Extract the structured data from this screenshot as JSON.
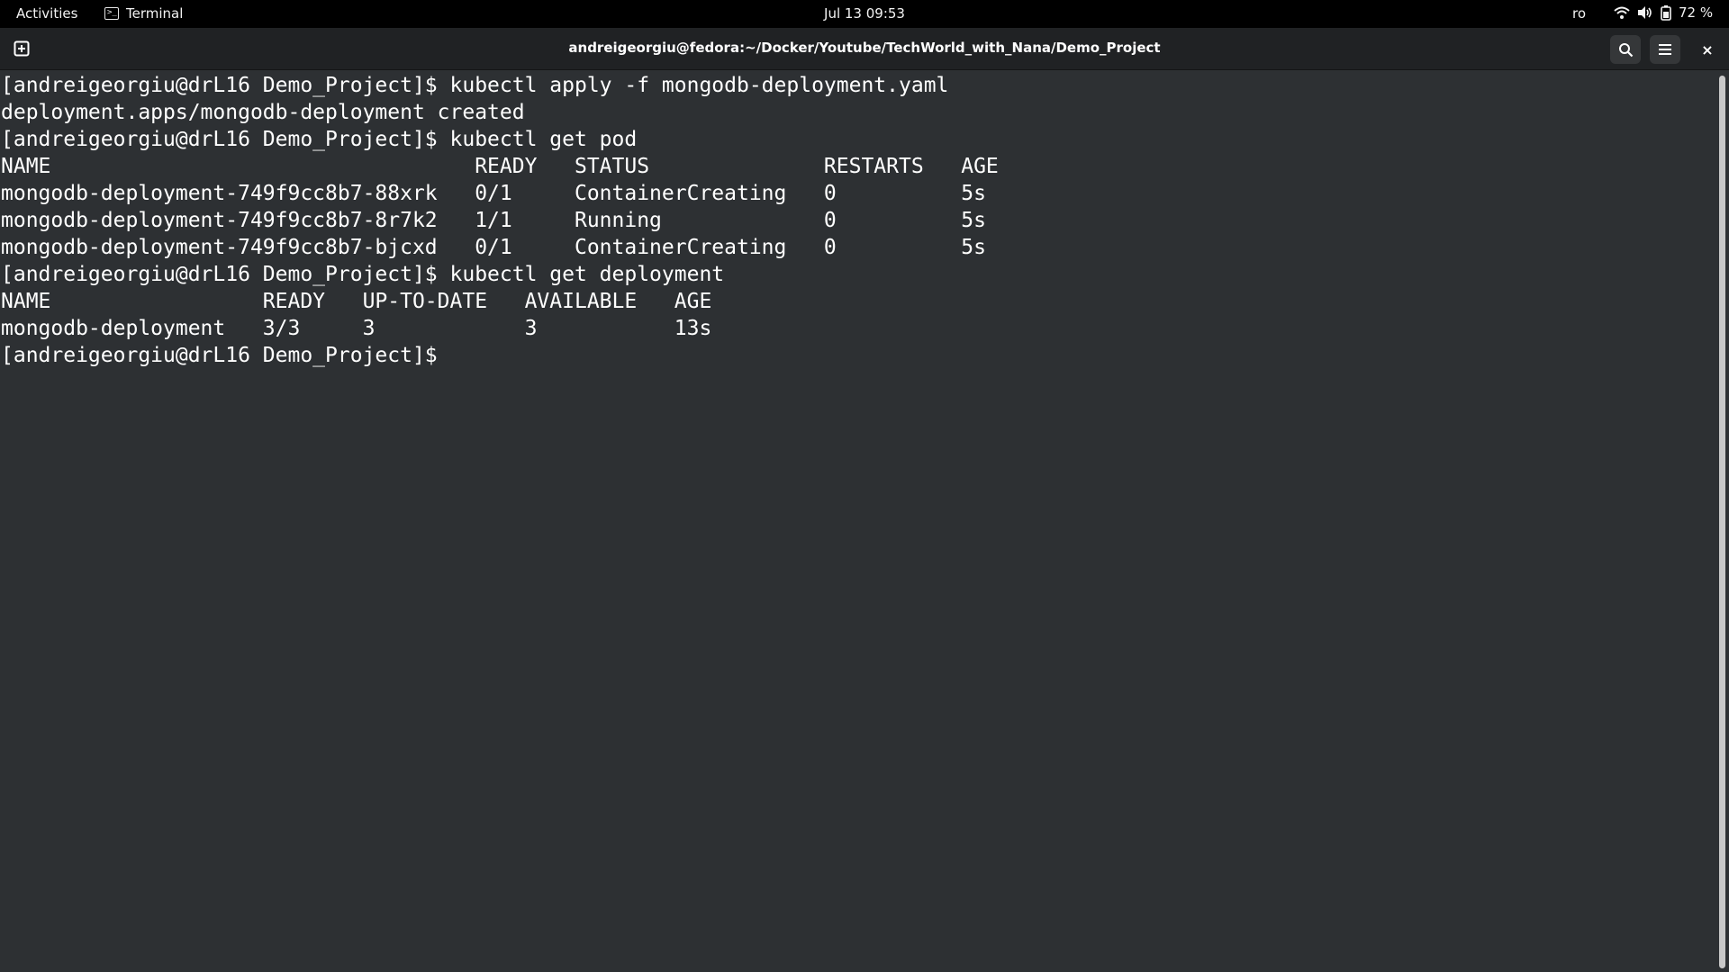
{
  "topbar": {
    "activities": "Activities",
    "app_name": "Terminal",
    "datetime": "Jul 13  09:53",
    "keyboard_layout": "ro",
    "battery": "72 %"
  },
  "window": {
    "title": "andreigeorgiu@fedora:~/Docker/Youtube/TechWorld_with_Nana/Demo_Project",
    "close_label": "×"
  },
  "terminal": {
    "lines": [
      "[andreigeorgiu@drL16 Demo_Project]$ kubectl apply -f mongodb-deployment.yaml",
      "deployment.apps/mongodb-deployment created",
      "[andreigeorgiu@drL16 Demo_Project]$ kubectl get pod",
      "NAME                                  READY   STATUS              RESTARTS   AGE",
      "mongodb-deployment-749f9cc8b7-88xrk   0/1     ContainerCreating   0          5s",
      "mongodb-deployment-749f9cc8b7-8r7k2   1/1     Running             0          5s",
      "mongodb-deployment-749f9cc8b7-bjcxd   0/1     ContainerCreating   0          5s",
      "[andreigeorgiu@drL16 Demo_Project]$ kubectl get deployment",
      "NAME                 READY   UP-TO-DATE   AVAILABLE   AGE",
      "mongodb-deployment   3/3     3            3           13s",
      "[andreigeorgiu@drL16 Demo_Project]$ "
    ]
  }
}
